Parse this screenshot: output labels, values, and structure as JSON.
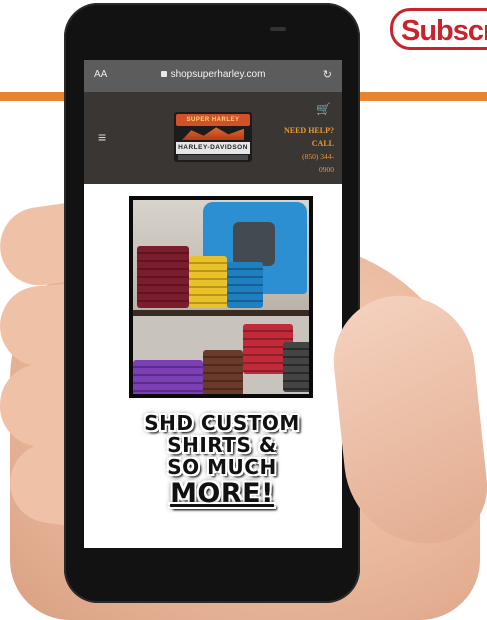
{
  "banner": {
    "subscribe_label": "Subscri"
  },
  "browser": {
    "text_size_label": "AA",
    "url": "shopsuperharley.com",
    "reload_glyph": "↻"
  },
  "site": {
    "logo_top": "SUPER HARLEY",
    "logo_bottom": "HARLEY-DAVIDSON",
    "help_line1": "NEED HELP?",
    "help_line2": "CALL",
    "help_line3": "(850) 344-",
    "help_line4": "0900"
  },
  "promo": {
    "line1": "SHD CUSTOM",
    "line2": "SHIRTS &",
    "line3": "SO MUCH",
    "line4": "MORE!"
  },
  "colors": {
    "accent_orange": "#e8842e",
    "subscribe_red": "#c9242b",
    "header_bg": "#3a3634",
    "help_text": "#e79a38"
  }
}
